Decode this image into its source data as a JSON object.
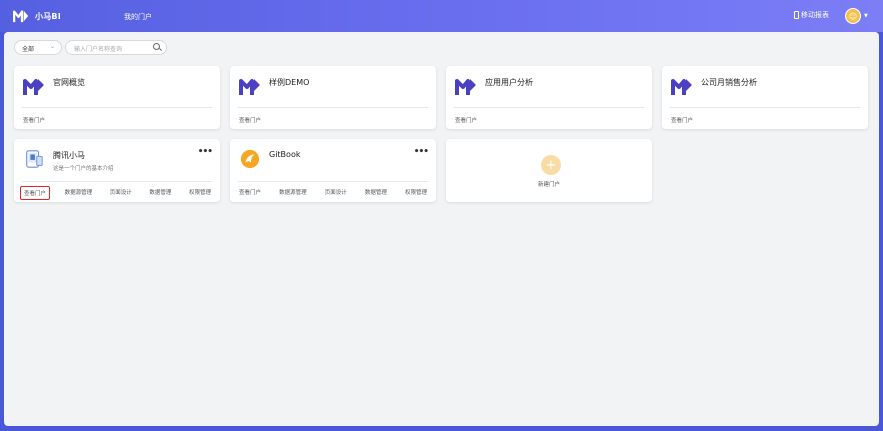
{
  "header": {
    "app_name": "小马BI",
    "nav_portal": "我的门户",
    "mobile_report": "移动报表"
  },
  "toolbar": {
    "filter_value": "全部",
    "search_placeholder": "输入门户名称查询"
  },
  "portals": [
    {
      "title": "官网概览",
      "actions": [
        "查看门户"
      ]
    },
    {
      "title": "样例DEMO",
      "actions": [
        "查看门户"
      ]
    },
    {
      "title": "应用用户分析",
      "actions": [
        "查看门户"
      ]
    },
    {
      "title": "公司月销售分析",
      "actions": [
        "查看门户"
      ]
    },
    {
      "title": "腾讯小马",
      "desc": "这是一个门户的基本介绍",
      "actions": [
        "查看门户",
        "数据源管理",
        "页面设计",
        "数据管理",
        "权限管理"
      ]
    },
    {
      "title": "GitBook",
      "actions": [
        "查看门户",
        "数据源管理",
        "页面设计",
        "数据管理",
        "权限管理"
      ]
    }
  ],
  "add_portal": {
    "label": "新建门户"
  },
  "colors": {
    "brand": "#4a57d6",
    "logo_purple": "#4b3fc4",
    "highlight": "#e0252b",
    "gitbook": "#f5a623"
  }
}
